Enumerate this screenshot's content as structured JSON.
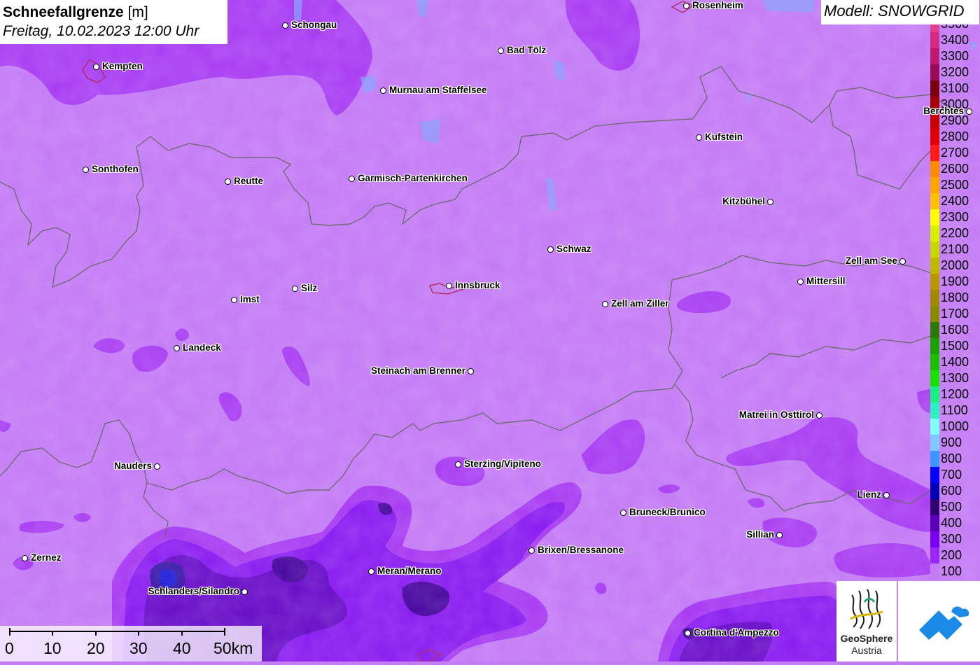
{
  "header": {
    "title_bold": "Schneefallgrenze",
    "title_unit": "[m]",
    "datetime": "Freitag, 10.02.2023 12:00 Uhr",
    "model": "Modell: SNOWGRID"
  },
  "legend": {
    "levels": [
      {
        "label": "3500",
        "color": "#e04090"
      },
      {
        "label": "3400",
        "color": "#d42a82"
      },
      {
        "label": "3300",
        "color": "#c01a70"
      },
      {
        "label": "3200",
        "color": "#9c0a5a"
      },
      {
        "label": "3100",
        "color": "#7a0010"
      },
      {
        "label": "3000",
        "color": "#a40000"
      },
      {
        "label": "2900",
        "color": "#c80000"
      },
      {
        "label": "2800",
        "color": "#e00000"
      },
      {
        "label": "2700",
        "color": "#ff1a1a"
      },
      {
        "label": "2600",
        "color": "#ff8c00"
      },
      {
        "label": "2500",
        "color": "#ffa500"
      },
      {
        "label": "2400",
        "color": "#ffc000"
      },
      {
        "label": "2300",
        "color": "#ffff00"
      },
      {
        "label": "2200",
        "color": "#d6f000"
      },
      {
        "label": "2100",
        "color": "#c8d600"
      },
      {
        "label": "2000",
        "color": "#c0b800"
      },
      {
        "label": "1900",
        "color": "#b89600"
      },
      {
        "label": "1800",
        "color": "#a08800"
      },
      {
        "label": "1700",
        "color": "#8a8a00"
      },
      {
        "label": "1600",
        "color": "#2a7a00"
      },
      {
        "label": "1500",
        "color": "#1aa000"
      },
      {
        "label": "1400",
        "color": "#1ac000"
      },
      {
        "label": "1300",
        "color": "#1ae000"
      },
      {
        "label": "1200",
        "color": "#1af080"
      },
      {
        "label": "1100",
        "color": "#30f0c0"
      },
      {
        "label": "1000",
        "color": "#80ffff"
      },
      {
        "label": "900",
        "color": "#80c8ff"
      },
      {
        "label": "800",
        "color": "#3c96ff"
      },
      {
        "label": "700",
        "color": "#0000ff"
      },
      {
        "label": "600",
        "color": "#0000b4"
      },
      {
        "label": "500",
        "color": "#32006e"
      },
      {
        "label": "400",
        "color": "#5a00b4"
      },
      {
        "label": "300",
        "color": "#7800f0"
      },
      {
        "label": "200",
        "color": "#9a28f5"
      },
      {
        "label": "100",
        "color": "#c47cf5"
      }
    ]
  },
  "cities": [
    {
      "name": "Rosenheim",
      "label_side": "right"
    },
    {
      "name": "Schongau",
      "label_side": "right"
    },
    {
      "name": "Kempten",
      "label_side": "right"
    },
    {
      "name": "Bad Tölz",
      "label_side": "right"
    },
    {
      "name": "Murnau am Staffelsee",
      "label_side": "right"
    },
    {
      "name": "Berchtes",
      "label_side": "left"
    },
    {
      "name": "Kufstein",
      "label_side": "right"
    },
    {
      "name": "Sonthofen",
      "label_side": "right"
    },
    {
      "name": "Reutte",
      "label_side": "right"
    },
    {
      "name": "Garmisch-Partenkirchen",
      "label_side": "right"
    },
    {
      "name": "Kitzbühel",
      "label_side": "left"
    },
    {
      "name": "Schwaz",
      "label_side": "right"
    },
    {
      "name": "Zell am See",
      "label_side": "left"
    },
    {
      "name": "Mittersill",
      "label_side": "right"
    },
    {
      "name": "Innsbruck",
      "label_side": "right"
    },
    {
      "name": "Silz",
      "label_side": "right"
    },
    {
      "name": "Imst",
      "label_side": "right"
    },
    {
      "name": "Zell am Ziller",
      "label_side": "right"
    },
    {
      "name": "Landeck",
      "label_side": "right"
    },
    {
      "name": "Steinach am Brenner",
      "label_side": "left"
    },
    {
      "name": "Matrei in Osttirol",
      "label_side": "left"
    },
    {
      "name": "Nauders",
      "label_side": "left"
    },
    {
      "name": "Sterzing/Vipiteno",
      "label_side": "right"
    },
    {
      "name": "Lienz",
      "label_side": "left"
    },
    {
      "name": "Bruneck/Brunico",
      "label_side": "right"
    },
    {
      "name": "Sillian",
      "label_side": "left"
    },
    {
      "name": "Brixen/Bressanone",
      "label_side": "right"
    },
    {
      "name": "Zernez",
      "label_side": "right"
    },
    {
      "name": "Meran/Merano",
      "label_side": "right"
    },
    {
      "name": "Schlanders/Silandro",
      "label_side": "left"
    },
    {
      "name": "Cortina d'Ampezzo",
      "label_side": "right"
    }
  ],
  "scale_bar": {
    "labels": [
      "0",
      "10",
      "20",
      "30",
      "40",
      "50km"
    ]
  },
  "logos": {
    "geosphere_line1": "GeoSphere",
    "geosphere_line2": "Austria"
  },
  "colors": {
    "base_100": "#c47cf5",
    "level_200": "#9a28f5",
    "level_300": "#7800f0",
    "level_400": "#5a00b4",
    "level_500": "#32006e",
    "level_700": "#2020e0",
    "border": "#666666",
    "water": "#8aa6ff"
  }
}
